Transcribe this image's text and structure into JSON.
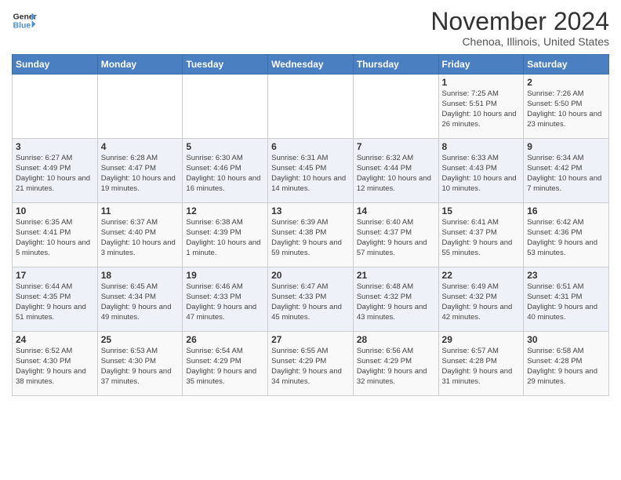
{
  "logo": {
    "line1": "General",
    "line2": "Blue"
  },
  "title": "November 2024",
  "location": "Chenoa, Illinois, United States",
  "days_header": [
    "Sunday",
    "Monday",
    "Tuesday",
    "Wednesday",
    "Thursday",
    "Friday",
    "Saturday"
  ],
  "weeks": [
    [
      {
        "day": "",
        "detail": ""
      },
      {
        "day": "",
        "detail": ""
      },
      {
        "day": "",
        "detail": ""
      },
      {
        "day": "",
        "detail": ""
      },
      {
        "day": "",
        "detail": ""
      },
      {
        "day": "1",
        "detail": "Sunrise: 7:25 AM\nSunset: 5:51 PM\nDaylight: 10 hours and 26 minutes."
      },
      {
        "day": "2",
        "detail": "Sunrise: 7:26 AM\nSunset: 5:50 PM\nDaylight: 10 hours and 23 minutes."
      }
    ],
    [
      {
        "day": "3",
        "detail": "Sunrise: 6:27 AM\nSunset: 4:49 PM\nDaylight: 10 hours and 21 minutes."
      },
      {
        "day": "4",
        "detail": "Sunrise: 6:28 AM\nSunset: 4:47 PM\nDaylight: 10 hours and 19 minutes."
      },
      {
        "day": "5",
        "detail": "Sunrise: 6:30 AM\nSunset: 4:46 PM\nDaylight: 10 hours and 16 minutes."
      },
      {
        "day": "6",
        "detail": "Sunrise: 6:31 AM\nSunset: 4:45 PM\nDaylight: 10 hours and 14 minutes."
      },
      {
        "day": "7",
        "detail": "Sunrise: 6:32 AM\nSunset: 4:44 PM\nDaylight: 10 hours and 12 minutes."
      },
      {
        "day": "8",
        "detail": "Sunrise: 6:33 AM\nSunset: 4:43 PM\nDaylight: 10 hours and 10 minutes."
      },
      {
        "day": "9",
        "detail": "Sunrise: 6:34 AM\nSunset: 4:42 PM\nDaylight: 10 hours and 7 minutes."
      }
    ],
    [
      {
        "day": "10",
        "detail": "Sunrise: 6:35 AM\nSunset: 4:41 PM\nDaylight: 10 hours and 5 minutes."
      },
      {
        "day": "11",
        "detail": "Sunrise: 6:37 AM\nSunset: 4:40 PM\nDaylight: 10 hours and 3 minutes."
      },
      {
        "day": "12",
        "detail": "Sunrise: 6:38 AM\nSunset: 4:39 PM\nDaylight: 10 hours and 1 minute."
      },
      {
        "day": "13",
        "detail": "Sunrise: 6:39 AM\nSunset: 4:38 PM\nDaylight: 9 hours and 59 minutes."
      },
      {
        "day": "14",
        "detail": "Sunrise: 6:40 AM\nSunset: 4:37 PM\nDaylight: 9 hours and 57 minutes."
      },
      {
        "day": "15",
        "detail": "Sunrise: 6:41 AM\nSunset: 4:37 PM\nDaylight: 9 hours and 55 minutes."
      },
      {
        "day": "16",
        "detail": "Sunrise: 6:42 AM\nSunset: 4:36 PM\nDaylight: 9 hours and 53 minutes."
      }
    ],
    [
      {
        "day": "17",
        "detail": "Sunrise: 6:44 AM\nSunset: 4:35 PM\nDaylight: 9 hours and 51 minutes."
      },
      {
        "day": "18",
        "detail": "Sunrise: 6:45 AM\nSunset: 4:34 PM\nDaylight: 9 hours and 49 minutes."
      },
      {
        "day": "19",
        "detail": "Sunrise: 6:46 AM\nSunset: 4:33 PM\nDaylight: 9 hours and 47 minutes."
      },
      {
        "day": "20",
        "detail": "Sunrise: 6:47 AM\nSunset: 4:33 PM\nDaylight: 9 hours and 45 minutes."
      },
      {
        "day": "21",
        "detail": "Sunrise: 6:48 AM\nSunset: 4:32 PM\nDaylight: 9 hours and 43 minutes."
      },
      {
        "day": "22",
        "detail": "Sunrise: 6:49 AM\nSunset: 4:32 PM\nDaylight: 9 hours and 42 minutes."
      },
      {
        "day": "23",
        "detail": "Sunrise: 6:51 AM\nSunset: 4:31 PM\nDaylight: 9 hours and 40 minutes."
      }
    ],
    [
      {
        "day": "24",
        "detail": "Sunrise: 6:52 AM\nSunset: 4:30 PM\nDaylight: 9 hours and 38 minutes."
      },
      {
        "day": "25",
        "detail": "Sunrise: 6:53 AM\nSunset: 4:30 PM\nDaylight: 9 hours and 37 minutes."
      },
      {
        "day": "26",
        "detail": "Sunrise: 6:54 AM\nSunset: 4:29 PM\nDaylight: 9 hours and 35 minutes."
      },
      {
        "day": "27",
        "detail": "Sunrise: 6:55 AM\nSunset: 4:29 PM\nDaylight: 9 hours and 34 minutes."
      },
      {
        "day": "28",
        "detail": "Sunrise: 6:56 AM\nSunset: 4:29 PM\nDaylight: 9 hours and 32 minutes."
      },
      {
        "day": "29",
        "detail": "Sunrise: 6:57 AM\nSunset: 4:28 PM\nDaylight: 9 hours and 31 minutes."
      },
      {
        "day": "30",
        "detail": "Sunrise: 6:58 AM\nSunset: 4:28 PM\nDaylight: 9 hours and 29 minutes."
      }
    ]
  ]
}
